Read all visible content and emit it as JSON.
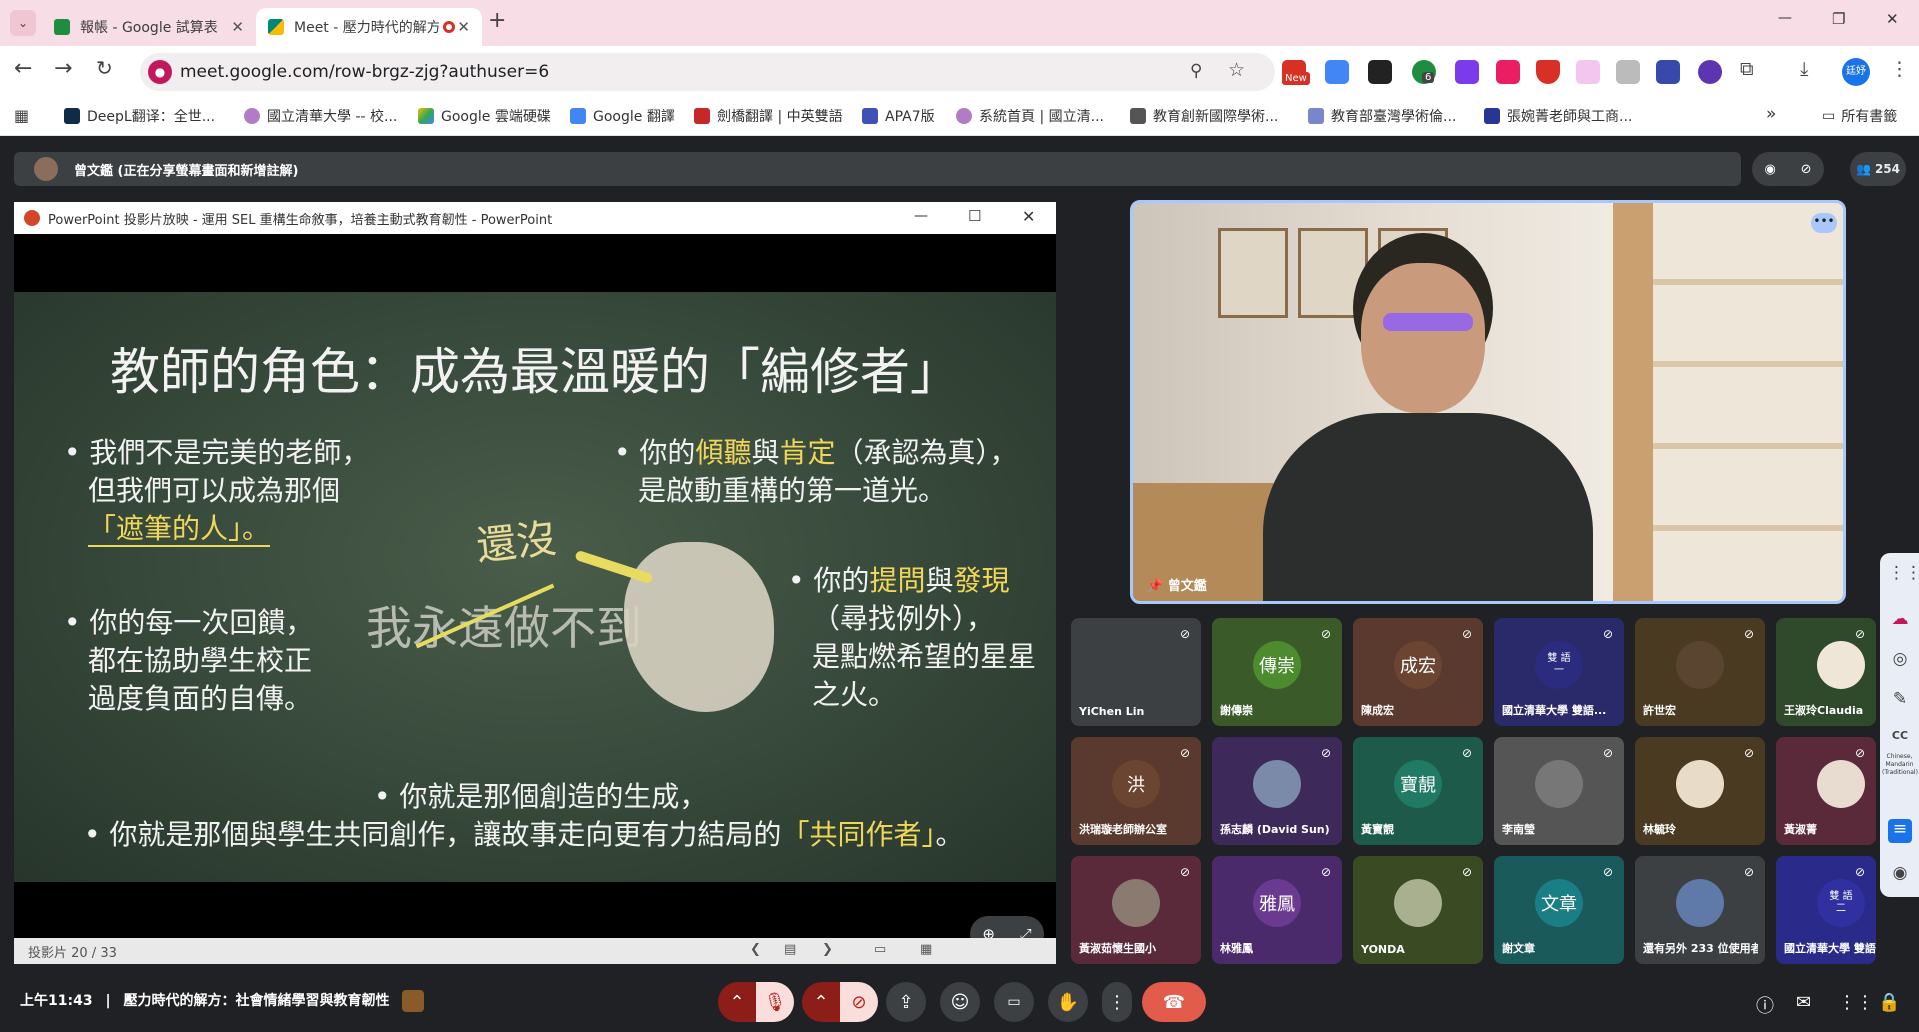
{
  "tabs": [
    {
      "label": "報帳 - Google 試算表",
      "favicon": "sheets-icon",
      "color": "#1e8e3e"
    },
    {
      "label": "Meet - 壓力時代的解方：社",
      "favicon": "meet-icon",
      "color": "#00897b"
    }
  ],
  "new_tab": "+",
  "window_controls": {
    "minimize": "—",
    "restore": "❐",
    "close": "✕"
  },
  "omnibox": {
    "url": "meet.google.com/row-brgz-zjg?authuser=6"
  },
  "extensions": {
    "new_badge": "New",
    "count_badge": "6",
    "profile": "廷妤"
  },
  "bookmarks": [
    "DeepL翻译：全世...",
    "國立清華大學 -- 校...",
    "Google 雲端硬碟",
    "Google 翻譯",
    "劍橋翻譯 | 中英雙語",
    "APA7版",
    "系統首頁 | 國立清...",
    "教育創新國際學術...",
    "教育部臺灣學術倫...",
    "張婉菁老師與工商..."
  ],
  "bookmarks_more": "»",
  "all_bookmarks": "所有書籤",
  "presenter_bar": {
    "text": "曾文鑑 (正在分享螢幕畫面和新增註解)",
    "participant_count": "254"
  },
  "ppt": {
    "title": "PowerPoint 投影片放映 - 運用 SEL 重構生命敘事，培養主動式教育韌性 - PowerPoint",
    "status": "投影片 20 / 33",
    "slide": {
      "heading": "教師的角色：成為最溫暖的「編修者」",
      "b1_line1": "我們不是完美的老師，",
      "b1_line2": "但我們可以成為那個",
      "b1_line3": "「遮筆的人」。",
      "b2_pre": "你的",
      "b2_y1": "傾聽",
      "b2_mid": "與",
      "b2_y2": "肯定",
      "b2_post": "（承認為真），",
      "b2_line2": "是啟動重構的第一道光。",
      "b3_line1": "你的每一次回饋，",
      "b3_line2": "都在協助學生校正",
      "b3_line3": "過度負面的自傳。",
      "b4_pre": "你的",
      "b4_y1": "提問",
      "b4_mid": "與",
      "b4_y2": "發現",
      "b4_line2": "（尋找例外），",
      "b4_line3": "是點燃希望的星星",
      "b4_line4": "之火。",
      "chalk1": "還沒",
      "chalk2": "我永遠做不到",
      "b5": "你就是那個創造的生成，",
      "b6_pre": "你就是那個與學生共同創作，讓故事走向更有力結局的",
      "b6_y": "「共同作者」",
      "b6_post": "。"
    }
  },
  "speaker": {
    "name": "曾文鑑"
  },
  "tiles": [
    {
      "name": "YiChen Lin",
      "initials": "",
      "bg": "#3c4043"
    },
    {
      "name": "謝傳崇",
      "initials": "傳崇",
      "bg": "#3a5a2a",
      "circle": "#4c8c2e"
    },
    {
      "name": "陳成宏",
      "initials": "成宏",
      "bg": "#5a3a2e",
      "circle": "#6b4432"
    },
    {
      "name": "國立清華大學 雙語...",
      "initials": "雙 語\n一",
      "bg": "#2a2a6a",
      "circle": "#2b2b80"
    },
    {
      "name": "許世宏",
      "initials": "",
      "bg": "#4a3a22",
      "circle": "#5a4530"
    },
    {
      "name": "王淑玲Claudia",
      "initials": "",
      "bg": "#2e4a2a",
      "circle": "#f0e6d8"
    },
    {
      "name": "洪瑞璇老師辦公室",
      "initials": "洪",
      "bg": "#5a3a2e",
      "circle": "#6b4432"
    },
    {
      "name": "孫志麟 (David Sun)",
      "initials": "",
      "bg": "#3e2a5a",
      "circle": "#7a8aa8"
    },
    {
      "name": "黃寶靚",
      "initials": "寶靚",
      "bg": "#1e5a4a",
      "circle": "#217a63"
    },
    {
      "name": "李南瑩",
      "initials": "",
      "bg": "#555",
      "circle": "#777"
    },
    {
      "name": "林毓玲",
      "initials": "",
      "bg": "#4a3a22",
      "circle": "#e8dcc8"
    },
    {
      "name": "黃淑菁",
      "initials": "",
      "bg": "#5a2a3a",
      "circle": "#e8dcd0"
    },
    {
      "name": "黃淑茹懷生國小",
      "initials": "",
      "bg": "#5a2a3a",
      "circle": "#8a7a70"
    },
    {
      "name": "林雅鳳",
      "initials": "雅鳳",
      "bg": "#4a2a6a",
      "circle": "#6a3a90"
    },
    {
      "name": "YONDA",
      "initials": "",
      "bg": "#3a4a22",
      "circle": "#a8b090"
    },
    {
      "name": "謝文章",
      "initials": "文章",
      "bg": "#1a5a5a",
      "circle": "#1a7f84"
    },
    {
      "name": "還有另外 233 位使用者",
      "initials": "",
      "bg": "#3c4043",
      "circle": "#5f7aa8"
    },
    {
      "name": "國立清華大學 雙語...",
      "initials": "雙 語\n二",
      "bg": "#2a2a8a",
      "circle": "#3030a0"
    }
  ],
  "bottom": {
    "time": "上午11:43",
    "separator": "|",
    "meeting_title": "壓力時代的解方：社會情緒學習與教育韌性"
  }
}
